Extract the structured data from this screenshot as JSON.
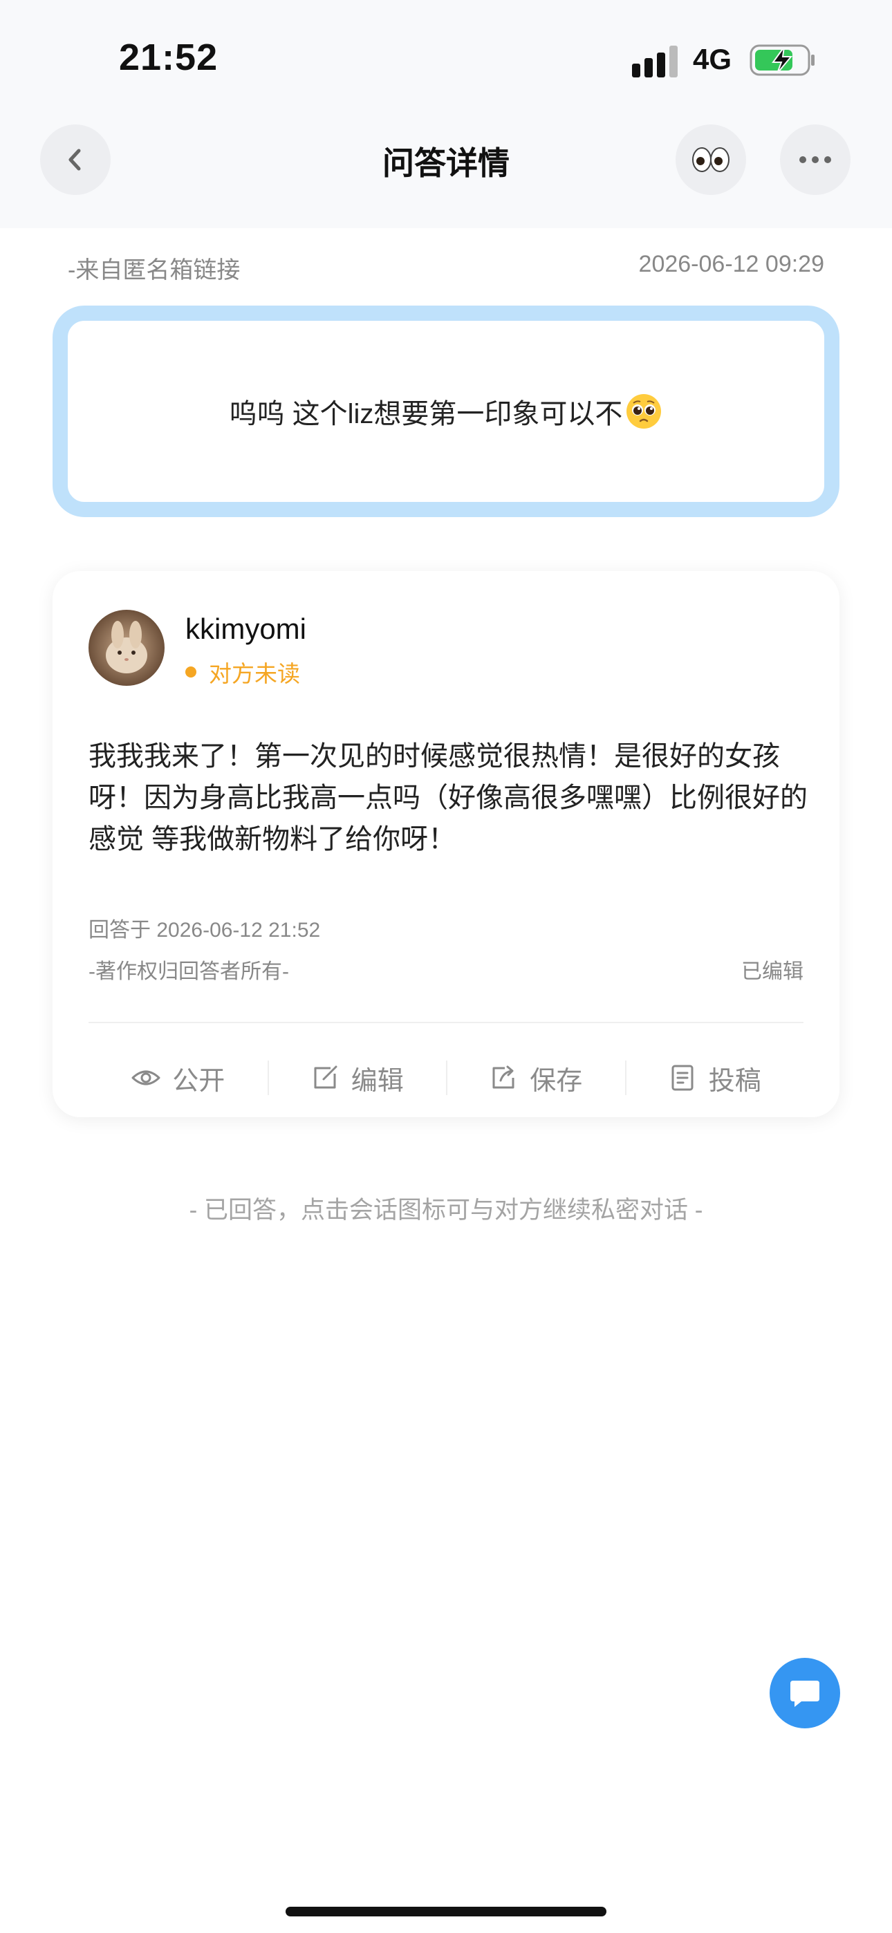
{
  "status_bar": {
    "time": "21:52",
    "network": "4G",
    "icons": [
      "signal-icon",
      "battery-charging-icon"
    ]
  },
  "nav": {
    "title": "问答详情",
    "back_icon": "chevron-left-icon",
    "eyes_emoji": "👀",
    "more_icon": "more-dots-icon"
  },
  "question": {
    "source": "-来自匿名箱链接",
    "timestamp": "2026-06-12 09:29",
    "text": "呜呜 这个liz想要第一印象可以不",
    "emoji": "pleading-face-emoji"
  },
  "answer": {
    "username": "kkimyomi",
    "read_status": "对方未读",
    "body": "我我我来了！第一次见的时候感觉很热情！是很好的女孩呀！因为身高比我高一点吗（好像高很多嘿嘿）比例很好的感觉 等我做新物料了给你呀！",
    "answered_at": "回答于 2026-06-12 21:52",
    "copyright": "-著作权归回答者所有-",
    "edited": "已编辑",
    "actions": [
      {
        "label": "公开",
        "icon": "eye-icon"
      },
      {
        "label": "编辑",
        "icon": "edit-icon"
      },
      {
        "label": "保存",
        "icon": "share-icon"
      },
      {
        "label": "投稿",
        "icon": "submit-doc-icon"
      }
    ]
  },
  "footer_note": "- 已回答，点击会话图标可与对方继续私密对话 -",
  "fab": {
    "icon": "chat-bubble-icon"
  },
  "colors": {
    "accent_blue": "#3596f2",
    "question_border": "#bfe1fb",
    "status_orange": "#f5a623",
    "battery_green": "#34c759"
  }
}
